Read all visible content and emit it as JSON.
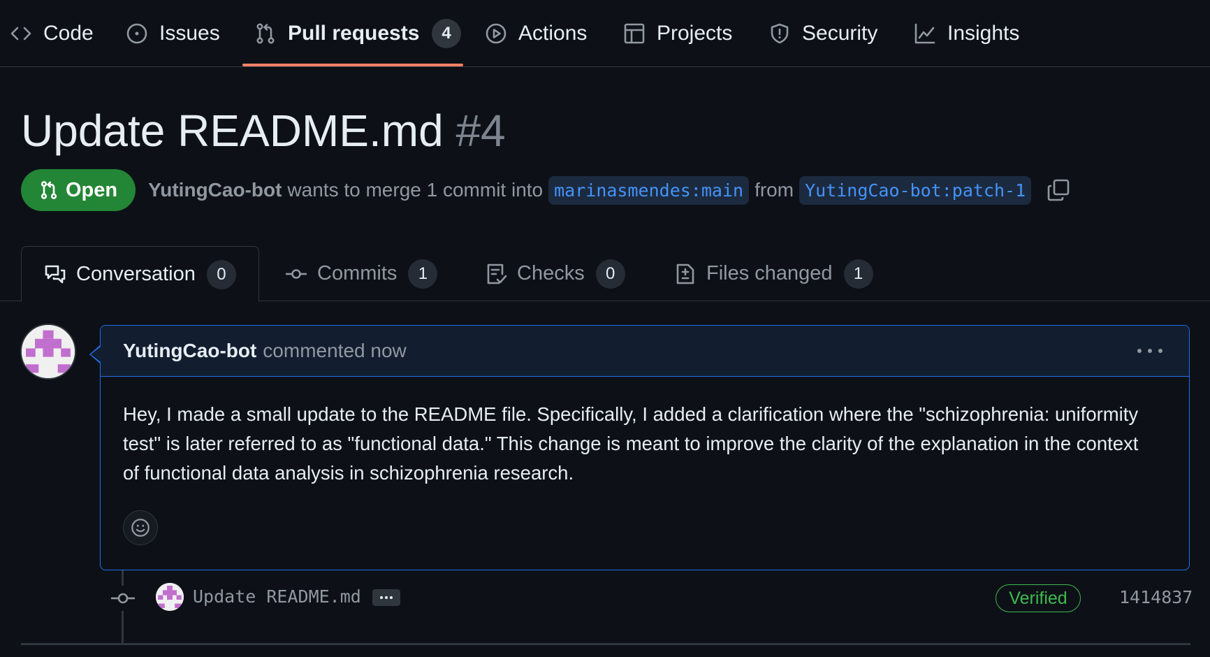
{
  "nav": {
    "items": [
      {
        "label": "Code",
        "icon": "code-icon"
      },
      {
        "label": "Issues",
        "icon": "issue-opened-icon"
      },
      {
        "label": "Pull requests",
        "icon": "git-pull-request-icon",
        "count": "4",
        "active": true
      },
      {
        "label": "Actions",
        "icon": "play-icon"
      },
      {
        "label": "Projects",
        "icon": "table-icon"
      },
      {
        "label": "Security",
        "icon": "shield-icon"
      },
      {
        "label": "Insights",
        "icon": "graph-icon"
      }
    ]
  },
  "pr": {
    "title": "Update README.md",
    "number": "#4",
    "state": "Open",
    "author": "YutingCao-bot",
    "merge_text": "wants to merge 1 commit into",
    "base_branch": "marinasmendes:main",
    "from_text": "from",
    "head_branch": "YutingCao-bot:patch-1"
  },
  "tabs": [
    {
      "label": "Conversation",
      "count": "0",
      "icon": "comment-discussion-icon",
      "active": true
    },
    {
      "label": "Commits",
      "count": "1",
      "icon": "git-commit-icon"
    },
    {
      "label": "Checks",
      "count": "0",
      "icon": "checklist-icon"
    },
    {
      "label": "Files changed",
      "count": "1",
      "icon": "file-diff-icon"
    }
  ],
  "comment": {
    "author": "YutingCao-bot",
    "when": "commented now",
    "body": "Hey, I made a small update to the README file. Specifically, I added a clarification where the \"schizophrenia: uniformity test\" is later referred to as \"functional data.\" This change is meant to improve the clarity of the explanation in the context of functional data analysis in schizophrenia research."
  },
  "timeline": {
    "commit_message": "Update README.md",
    "verified_label": "Verified",
    "sha": "1414837"
  },
  "colors": {
    "background": "#0d1117",
    "open_green": "#238636",
    "link_blue": "#4493f8",
    "active_underline": "#f78166",
    "avatar_purple": "#c16fce"
  }
}
